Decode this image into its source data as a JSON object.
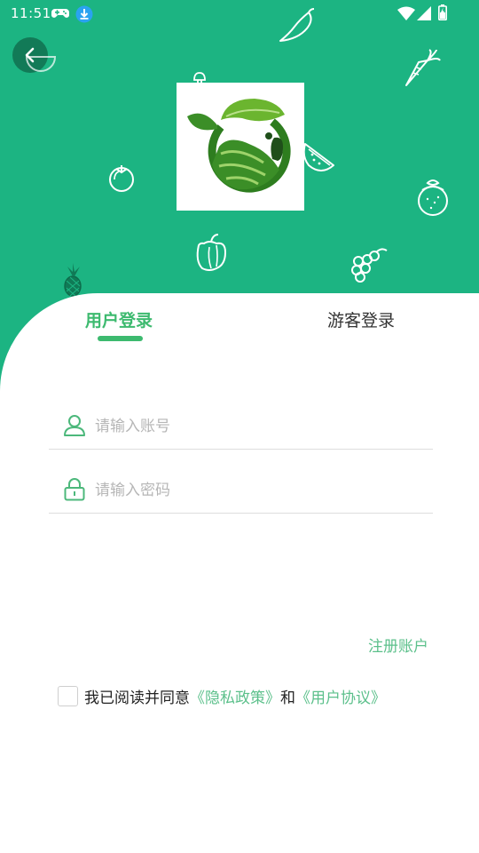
{
  "status_bar": {
    "time": "11:51",
    "icons": [
      "gamepad-icon",
      "download-icon",
      "wifi-icon",
      "signal-icon",
      "battery-icon"
    ]
  },
  "colors": {
    "brand_green": "#1cb482",
    "accent_green": "#3dba6f",
    "link_green": "#5cc08b",
    "placeholder": "#b6b6b6"
  },
  "tabs": {
    "user_login": "用户登录",
    "guest_login": "游客登录",
    "active": "user_login"
  },
  "form": {
    "account_placeholder": "请输入账号",
    "password_placeholder": "请输入密码",
    "account_value": "",
    "password_value": ""
  },
  "register_link": "注册账户",
  "agreement": {
    "prefix": "我已阅读并同意",
    "privacy_link": "《隐私政策》",
    "conjunction": "和",
    "user_agreement_link": "《用户协议》",
    "checked": false
  },
  "decorations": [
    "chili-icon",
    "carrot-icon",
    "watermelon-icon",
    "tomato-icon",
    "orange-icon",
    "pepper-icon",
    "pineapple-icon",
    "grapes-icon",
    "mushroom-icon"
  ]
}
